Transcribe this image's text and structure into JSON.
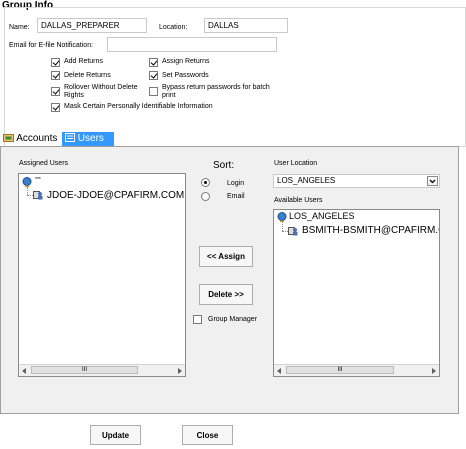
{
  "group_info": {
    "title": "Group Info",
    "name_label": "Name:",
    "name_value": "DALLAS_PREPARER",
    "location_label": "Location:",
    "location_value": "DALLAS",
    "email_label": "Email for E-file Notification:",
    "email_value": "",
    "permissions": [
      {
        "label": "Add Returns",
        "checked": true
      },
      {
        "label": "Assign Returns",
        "checked": true
      },
      {
        "label": "Delete Returns",
        "checked": true
      },
      {
        "label": "Set Passwords",
        "checked": true
      },
      {
        "label": "Rollover Without Delete Rights",
        "checked": true
      },
      {
        "label": "Bypass return passwords for batch print",
        "checked": false
      },
      {
        "label": "Mask Certain Personally Identifiable Information",
        "checked": true
      }
    ]
  },
  "tabs": [
    {
      "label": "Accounts",
      "active": false
    },
    {
      "label": "Users",
      "active": true
    }
  ],
  "users_panel": {
    "assigned_label": "Assigned Users",
    "assigned_root": "***",
    "assigned_users": [
      "JDOE-JDOE@CPAFIRM.COM"
    ],
    "sort_label": "Sort:",
    "sort_options": [
      {
        "label": "Login",
        "selected": true
      },
      {
        "label": "Email",
        "selected": false
      }
    ],
    "assign_button": "<< Assign",
    "delete_button": "Delete >>",
    "group_manager_label": "Group Manager",
    "group_manager_checked": false,
    "user_location_label": "User Location",
    "user_location_value": "LOS_ANGELES",
    "available_label": "Available Users",
    "available_root": "LOS_ANGELES",
    "available_users": [
      "BSMITH-BSMITH@CPAFIRM.COM"
    ],
    "scroll_grip": "III"
  },
  "footer": {
    "update_button": "Update",
    "close_button": "Close"
  },
  "colors": {
    "active_tab": "#3399ff",
    "panel_bg": "#f0f0f0"
  }
}
